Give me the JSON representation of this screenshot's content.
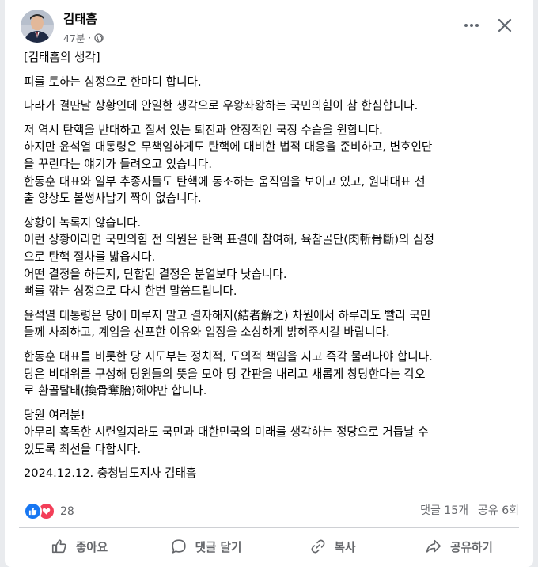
{
  "post": {
    "author": "김태흠",
    "time": "47분",
    "separator": "·",
    "audience_icon": "globe-icon",
    "lines": {
      "l1": "[김태흠의 생각]",
      "l2": "피를 토하는 심정으로 한마디 합니다.",
      "l3": "나라가 결딴날 상황인데 안일한 생각으로 우왕좌왕하는 국민의힘이 참 한심합니다.",
      "l4": "저 역시 탄핵을 반대하고 질서 있는 퇴진과 안정적인 국정 수습을 원합니다.",
      "l5": "하지만 윤석열 대통령은 무책임하게도 탄핵에 대비한 법적 대응을 준비하고, 변호인단",
      "l6": "을 꾸린다는 얘기가 들려오고 있습니다.",
      "l7": "한동훈 대표와 일부 추종자들도 탄핵에 동조하는 움직임을 보이고 있고, 원내대표 선",
      "l8": "출 양상도 볼썽사납기 짝이 없습니다.",
      "l9": "상황이 녹록지 않습니다.",
      "l10": "이런 상황이라면 국민의힘 전 의원은 탄핵 표결에 참여해, 육참골단(肉斬骨斷)의 심정",
      "l11": "으로 탄핵 절차를 밟읍시다.",
      "l12": "어떤 결정을 하든지, 단합된 결정은 분열보다 낫습니다.",
      "l13": "뼈를 깎는 심정으로 다시 한번 말씀드립니다.",
      "l14": "윤석열 대통령은 당에 미루지 말고 결자해지(結者解之) 차원에서 하루라도 빨리 국민",
      "l15": "들께 사죄하고, 계엄을 선포한 이유와 입장을 소상하게 밝혀주시길 바랍니다.",
      "l16": "한동훈 대표를 비롯한 당 지도부는 정치적, 도의적 책임을 지고 즉각 물러나야 합니다.",
      "l17": "당은 비대위를 구성해 당원들의 뜻을 모아 당 간판을 내리고 새롭게 창당한다는 각오",
      "l18": "로 환골탈태(換骨奪胎)해야만 합니다.",
      "l19": "당원 여러분!",
      "l20": "아무리 혹독한 시련일지라도 국민과 대한민국의 미래를 생각하는 정당으로 거듭날 수",
      "l21": "있도록 최선을 다합시다.",
      "l22": "2024.12.12. 충청남도지사 김태흠"
    }
  },
  "engagement": {
    "reaction_count": "28",
    "comments": "댓글 15개",
    "shares": "공유 6회",
    "colors": {
      "like": "#1877f2",
      "love": "#f33e58"
    }
  },
  "actions": {
    "like": "좋아요",
    "comment": "댓글 달기",
    "copy": "복사",
    "share": "공유하기"
  }
}
